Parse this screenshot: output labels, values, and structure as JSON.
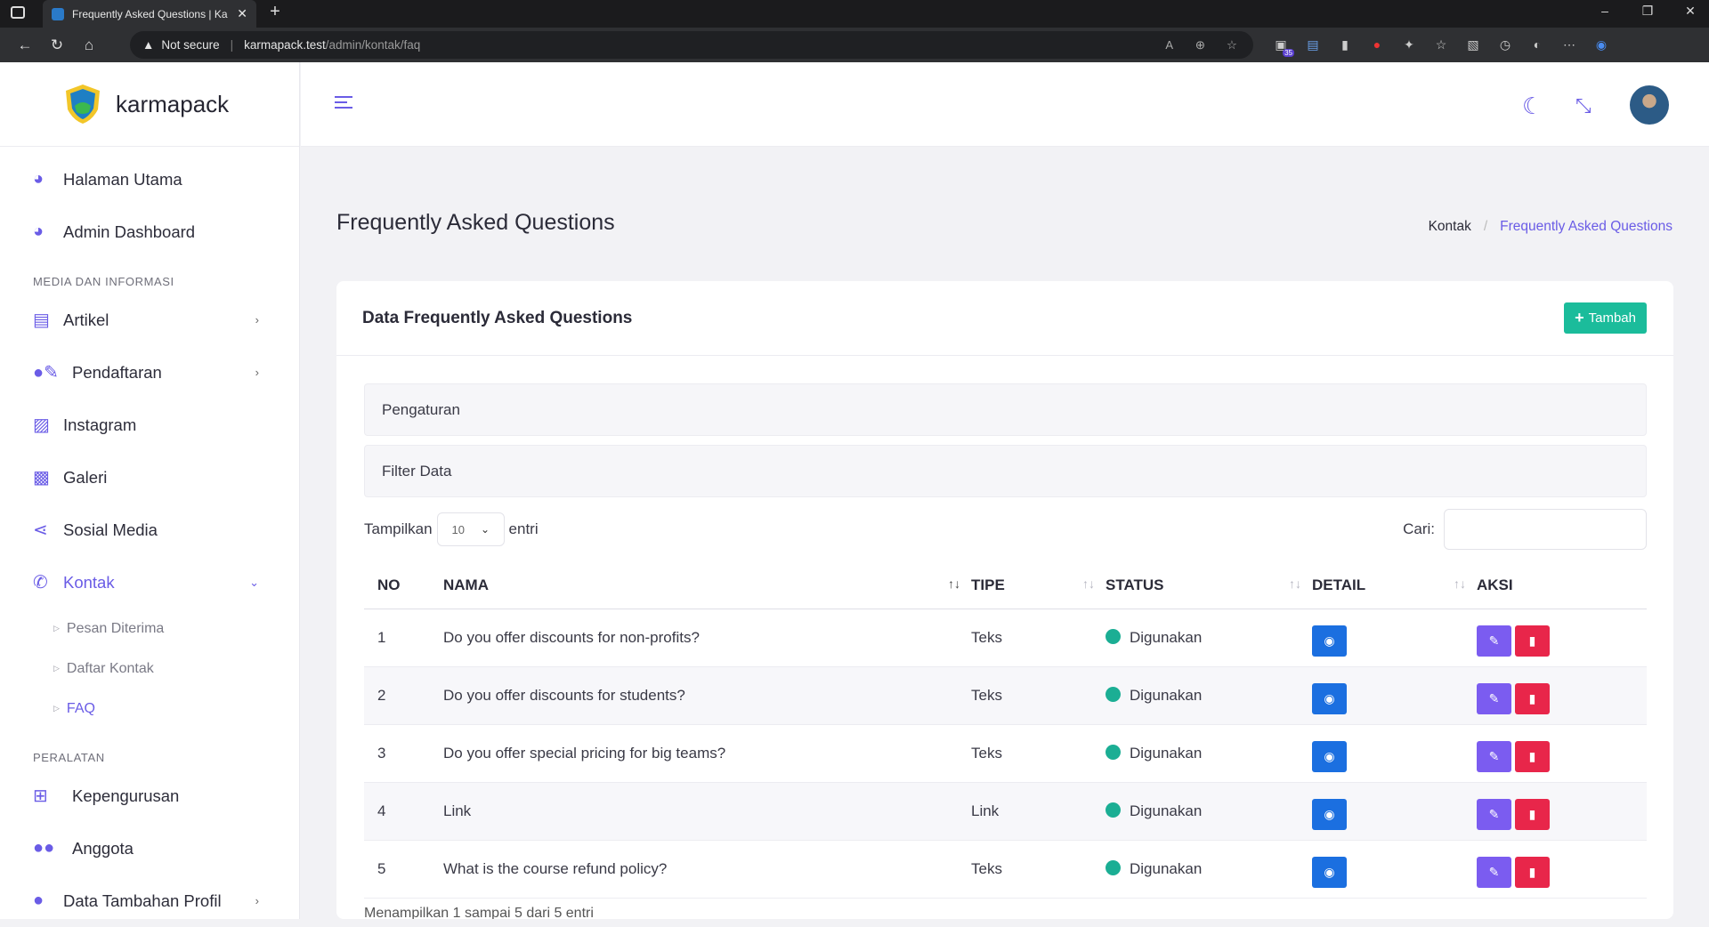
{
  "browser": {
    "tab_title": "Frequently Asked Questions | Ka",
    "security": "Not secure",
    "url_host": "karmapack.test",
    "url_path": "/admin/kontak/faq",
    "ext_badge": "35"
  },
  "brand": {
    "name": "karmapack"
  },
  "sidebar": {
    "items_top": [
      {
        "label": "Halaman Utama",
        "icon": "dashboard-icon"
      },
      {
        "label": "Admin Dashboard",
        "icon": "dashboard-icon"
      }
    ],
    "section_media": "MEDIA DAN INFORMASI",
    "items_media": [
      {
        "label": "Artikel",
        "icon": "file-icon"
      },
      {
        "label": "Pendaftaran",
        "icon": "user-edit-icon"
      },
      {
        "label": "Instagram",
        "icon": "image-icon"
      },
      {
        "label": "Galeri",
        "icon": "images-icon"
      },
      {
        "label": "Sosial Media",
        "icon": "share-icon"
      },
      {
        "label": "Kontak",
        "icon": "phone-icon"
      }
    ],
    "kontak_sub": [
      "Pesan Diterima",
      "Daftar Kontak",
      "FAQ"
    ],
    "section_tools": "PERALATAN",
    "items_tools": [
      {
        "label": "Kepengurusan",
        "icon": "sitemap-icon"
      },
      {
        "label": "Anggota",
        "icon": "users-icon"
      },
      {
        "label": "Data Tambahan Profil",
        "icon": "user-icon"
      }
    ]
  },
  "page": {
    "title": "Frequently Asked Questions",
    "breadcrumb": [
      "Kontak",
      "Frequently Asked Questions"
    ]
  },
  "card": {
    "title": "Data Frequently Asked Questions",
    "add_label": "Tambah",
    "accordion_settings": "Pengaturan",
    "accordion_filter": "Filter Data",
    "show_label": "Tampilkan",
    "show_value": "10",
    "entries_label": "entri",
    "search_label": "Cari:",
    "search_value": "",
    "footer_info": "Menampilkan 1 sampai 5 dari 5 entri"
  },
  "table": {
    "headers": [
      "NO",
      "NAMA",
      "TIPE",
      "STATUS",
      "DETAIL",
      "AKSI"
    ],
    "rows": [
      {
        "no": "1",
        "nama": "Do you offer discounts for non-profits?",
        "tipe": "Teks",
        "status": "Digunakan"
      },
      {
        "no": "2",
        "nama": "Do you offer discounts for students?",
        "tipe": "Teks",
        "status": "Digunakan"
      },
      {
        "no": "3",
        "nama": "Do you offer special pricing for big teams?",
        "tipe": "Teks",
        "status": "Digunakan"
      },
      {
        "no": "4",
        "nama": "Link",
        "tipe": "Link",
        "status": "Digunakan"
      },
      {
        "no": "5",
        "nama": "What is the course refund policy?",
        "tipe": "Teks",
        "status": "Digunakan"
      }
    ]
  },
  "colors": {
    "accent": "#6a5ce6",
    "add_button": "#1bbc9b",
    "view_button": "#1b6fe0",
    "edit_button": "#7b5cf0",
    "delete_button": "#e8264a",
    "status_dot": "#1bae94"
  }
}
